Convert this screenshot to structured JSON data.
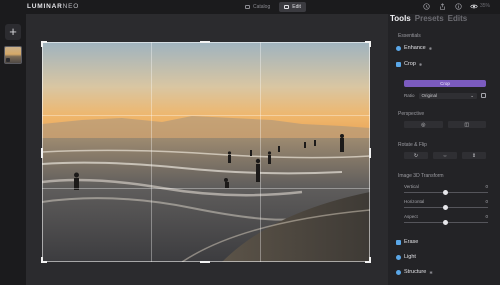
{
  "app": {
    "logo_main": "LUMINAR",
    "logo_sub": "NEO"
  },
  "topbar": {
    "modes": [
      {
        "label": "Catalog",
        "active": false
      },
      {
        "label": "Edit",
        "active": true
      }
    ],
    "zoom": "35%"
  },
  "leftbar": {
    "add_label": "+"
  },
  "panel": {
    "tabs": [
      {
        "label": "Tools",
        "active": true
      },
      {
        "label": "Presets",
        "active": false
      },
      {
        "label": "Edits",
        "active": false
      }
    ],
    "essentials_label": "Essentials",
    "enhance_label": "Enhance",
    "crop_label": "Crop",
    "crop_button": "Crop",
    "ratio_label": "Ratio",
    "ratio_value": "Original",
    "perspective_label": "Perspective",
    "rotate_flip_label": "Rotate & Flip",
    "image3d_label": "Image 3D Transform",
    "sliders": [
      {
        "label": "Vertical",
        "value": "0"
      },
      {
        "label": "Horizontal",
        "value": "0"
      },
      {
        "label": "Aspect",
        "value": "0"
      }
    ],
    "erase_label": "Erase",
    "light_label": "Light",
    "structure_label": "Structure",
    "accent_color": "#5aa7e8",
    "crop_button_color": "#7b5bbf"
  }
}
